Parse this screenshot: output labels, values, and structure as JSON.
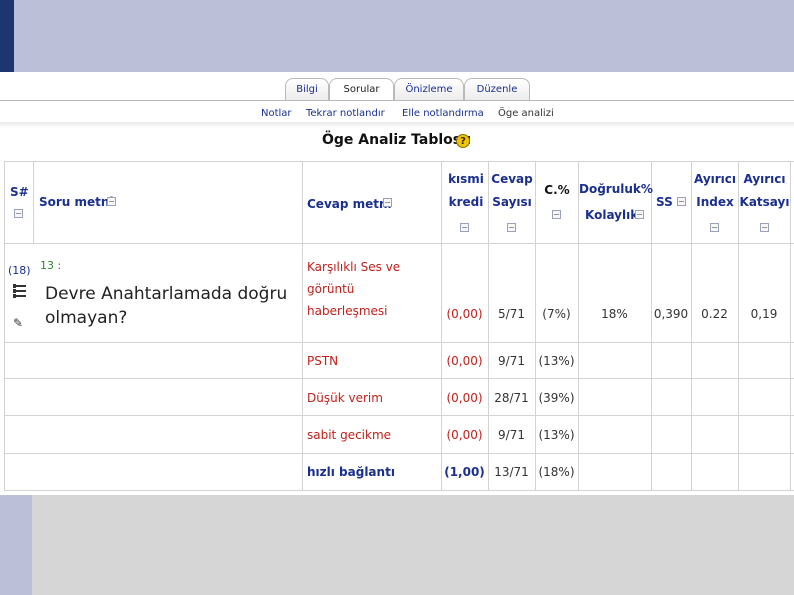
{
  "tabs": [
    "Bilgi",
    "Sorular",
    "Önizleme",
    "Düzenle"
  ],
  "active_tab": "Sorular",
  "subnav": [
    "Notlar",
    "Tekrar notlandır",
    "Elle notlandırma",
    "Öge analizi"
  ],
  "current_subnav": "Öge analizi",
  "page_title": "Öge Analiz Tablosu",
  "help_icon": "?",
  "columns": {
    "sno": "S#",
    "soru": "Soru metni",
    "cevap": "Cevap metni",
    "kismi_1": "kısmi",
    "kismi_2": "kredi",
    "sayi_1": "Cevap",
    "sayi_2": "Sayısı",
    "cpct": "C.%",
    "dk_1": "Doğruluk%",
    "dk_2": "Kolaylık",
    "ss": "SS",
    "ai_1": "Ayırıcı",
    "ai_2": "Index",
    "ak_1": "Ayırıcı",
    "ak_2": "Katsayı",
    "collapse_glyph": "−"
  },
  "question": {
    "count": "(18)",
    "number": "13 :",
    "text": "Devre Anahtarlamada doğru olmayan?",
    "dogruluk": "18%",
    "ss": "0,390",
    "ayirici_index": "0.22",
    "ayirici_katsayi": "0,19"
  },
  "answers": [
    {
      "text": "Karşılıklı Ses ve görüntü haberleşmesi",
      "kredi": "(0,00)",
      "sayi": "5/71",
      "pct": "(7%)",
      "correct": false
    },
    {
      "text": "PSTN",
      "kredi": "(0,00)",
      "sayi": "9/71",
      "pct": "(13%)",
      "correct": false
    },
    {
      "text": "Düşük verim",
      "kredi": "(0,00)",
      "sayi": "28/71",
      "pct": "(39%)",
      "correct": false
    },
    {
      "text": "sabit gecikme",
      "kredi": "(0,00)",
      "sayi": "9/71",
      "pct": "(13%)",
      "correct": false
    },
    {
      "text": "hızlı bağlantı",
      "kredi": "(1,00)",
      "sayi": "13/71",
      "pct": "(18%)",
      "correct": true
    }
  ],
  "colors": {
    "slide_band": "#bbc0d8",
    "slide_accent": "#1f3571",
    "link_blue": "#1a2f8f",
    "answer_red": "#c0201a",
    "number_green": "#2a8a2a"
  }
}
